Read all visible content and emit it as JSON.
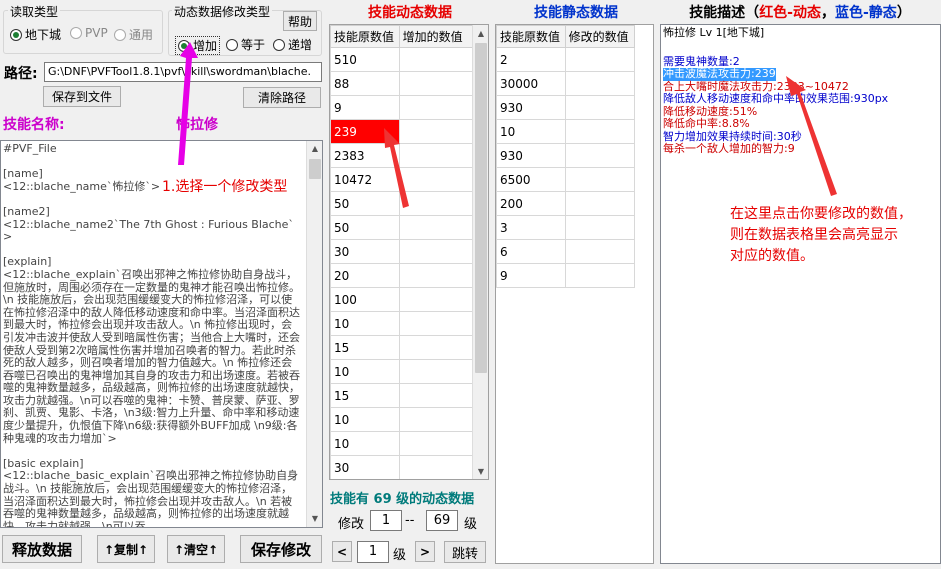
{
  "read_type": {
    "title": "读取类型",
    "options": [
      {
        "label": "地下城",
        "selected": true,
        "disabled": false
      },
      {
        "label": "PVP",
        "selected": false,
        "disabled": true
      },
      {
        "label": "通用",
        "selected": false,
        "disabled": true
      }
    ]
  },
  "modify_type": {
    "title": "动态数据修改类型",
    "help_label": "帮助",
    "options": [
      {
        "label": "增加",
        "selected": true
      },
      {
        "label": "等于",
        "selected": false
      },
      {
        "label": "递增",
        "selected": false
      }
    ]
  },
  "path": {
    "label": "路径:",
    "value": "G:\\DNF\\PVFTool1.8.1\\pvf\\skill\\swordman\\blache.",
    "save_button": "保存到文件",
    "clear_button": "清除路径"
  },
  "skill_name": {
    "label": "技能名称:",
    "value": "怖拉修"
  },
  "pvf_text": [
    "#PVF_File",
    "",
    "[name]",
    "<12::blache_name`怖拉修`>",
    "",
    "[name2]",
    "<12::blache_name2`The 7th Ghost : Furious Blache`>",
    "",
    "[explain]",
    "<12::blache_explain`召唤出邪神之怖拉修协助自身战斗，但施放时，周围必须存在一定数量的鬼神才能召唤出怖拉修。\\n 技能施放后，会出现范围缓缓变大的怖拉修沼泽，可以使在怖拉修沼泽中的敌人降低移动速度和命中率。当沼泽面积达到最大时，怖拉修会出现并攻击敌人。\\n 怖拉修出现时，会引发冲击波并使敌人受到暗属性伤害；当他合上大嘴时，还会使敌人受到第2次暗属性伤害并增加召唤者的智力。若此时杀死的敌人越多，则召唤者增加的智力值越大。\\n 怖拉修还会吞噬已召唤出的鬼神增加其自身的攻击力和出场速度。若被吞噬的鬼神数量越多，品级越高，则怖拉修的出场速度就越快，攻击力就越强。\\n可以吞噬的鬼神：卡赞、普戾蒙、萨亚、罗刹、凯贾、鬼影、卡洛，\\n3级:智力上升量、命中率和移动速度少量提升，仇恨值下降\\n6级:获得额外BUFF加成 \\n9级:各种鬼魂的攻击力增加`>",
    "",
    "[basic explain]",
    "<12::blache_basic_explain`召唤出邪神之怖拉修协助自身战斗。\\n 技能施放后，会出现范围缓缓变大的怖拉修沼泽，当沼泽面积达到最大时，怖拉修会出现并攻击敌人。\\n 若被吞噬的鬼神数量越多，品级越高，则怖拉修的出场速度就越快，攻击力就越强。\\n可以吞"
  ],
  "bottom_buttons": {
    "release": "释放数据",
    "copy": "↑复制↑",
    "clear": "↑清空↑",
    "save": "保存修改"
  },
  "dynamic": {
    "title": "技能动态数据",
    "col1": "技能原数值",
    "col2": "增加的数值",
    "values": [
      "510",
      "88",
      "9",
      "239",
      "2383",
      "10472",
      "50",
      "50",
      "30",
      "20",
      "100",
      "10",
      "15",
      "10",
      "15",
      "10",
      "10",
      "30"
    ],
    "highlight_index": 3,
    "level_count_text": "技能有 69 级的动态数据",
    "modify_label": "修改",
    "from_level": "1",
    "dash": "--",
    "to_level": "69",
    "level_unit": "级",
    "page_level": "1",
    "page_unit": "级",
    "prev": "<",
    "next": ">",
    "jump": "跳转"
  },
  "static": {
    "title": "技能静态数据",
    "col1": "技能原数值",
    "col2": "修改的数值",
    "values": [
      "2",
      "30000",
      "930",
      "10",
      "930",
      "6500",
      "200",
      "3",
      "6",
      "9"
    ]
  },
  "description": {
    "title_prefix": "技能描述（",
    "title_red": "红色-动态",
    "title_sep": "，",
    "title_blue": "蓝色-静态",
    "title_suffix": "）",
    "header": "怖拉修  Lv 1[地下城]",
    "lines": [
      {
        "text": "需要鬼神数量:2",
        "color": "#0000cc",
        "selected": false
      },
      {
        "text": "冲击波魔法攻击力:239",
        "color": "#ffffff",
        "selected": true
      },
      {
        "text": "合上大嘴时魔法攻击力:2383~10472",
        "color": "#cc0000",
        "selected": false
      },
      {
        "text": "降低敌人移动速度和命中率的效果范围:930px",
        "color": "#0000cc",
        "selected": false
      },
      {
        "text": "降低移动速度:51%",
        "color": "#cc0000",
        "selected": false
      },
      {
        "text": "降低命中率:8.8%",
        "color": "#cc0000",
        "selected": false
      },
      {
        "text": "智力增加效果持续时间:30秒",
        "color": "#0000cc",
        "selected": false
      },
      {
        "text": "每杀一个敌人增加的智力:9",
        "color": "#cc0000",
        "selected": false
      }
    ]
  },
  "annotations": {
    "step1": "1.选择一个修改类型",
    "tip": "在这里点击你要修改的数值，\n则在数据表格里会高亮显示\n对应的数值。"
  },
  "colors": {
    "red_label": "#e60000",
    "blue_title": "#0033cc",
    "magenta_label": "#cc00cc",
    "teal_label": "#007b7b",
    "highlight": "#ff0000",
    "selection": "#3399ff"
  }
}
